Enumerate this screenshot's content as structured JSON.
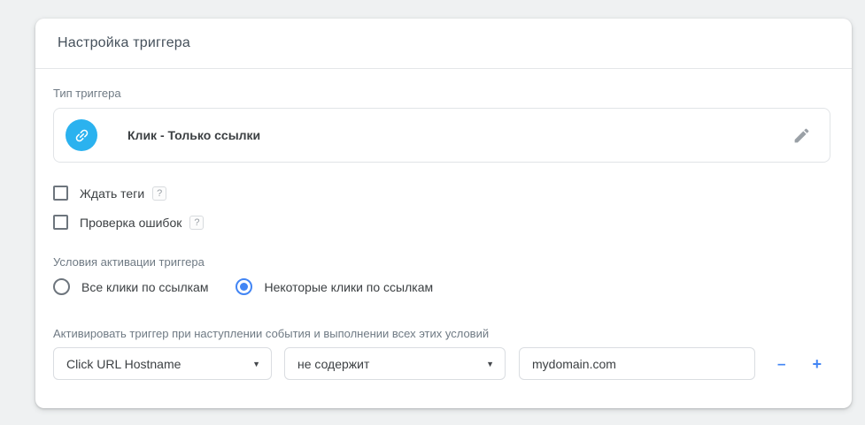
{
  "panel": {
    "title": "Настройка триггера"
  },
  "trigger_type": {
    "label": "Тип триггера",
    "name": "Клик - Только ссылки",
    "icon": "link-icon",
    "icon_bg_color": "#2bb2ef",
    "edit_icon": "pencil-icon"
  },
  "checkboxes": [
    {
      "label": "Ждать теги",
      "checked": false,
      "help": "?"
    },
    {
      "label": "Проверка ошибок",
      "checked": false,
      "help": "?"
    }
  ],
  "activation": {
    "label": "Условия активации триггера",
    "options": [
      {
        "label": "Все клики по ссылкам",
        "selected": false
      },
      {
        "label": "Некоторые клики по ссылкам",
        "selected": true
      }
    ]
  },
  "conditions": {
    "label": "Активировать триггер при наступлении события и выполнении всех этих условий",
    "rows": [
      {
        "variable": "Click URL Hostname",
        "operator": "не содержит",
        "value": "mydomain.com"
      }
    ],
    "caret": "▼",
    "remove_label": "–",
    "add_label": "+"
  },
  "colors": {
    "accent_blue": "#4285f4",
    "trigger_icon_blue": "#2bb2ef",
    "page_background": "#eff1f2",
    "text_primary": "#3c4043",
    "text_secondary": "#6f7a84"
  }
}
